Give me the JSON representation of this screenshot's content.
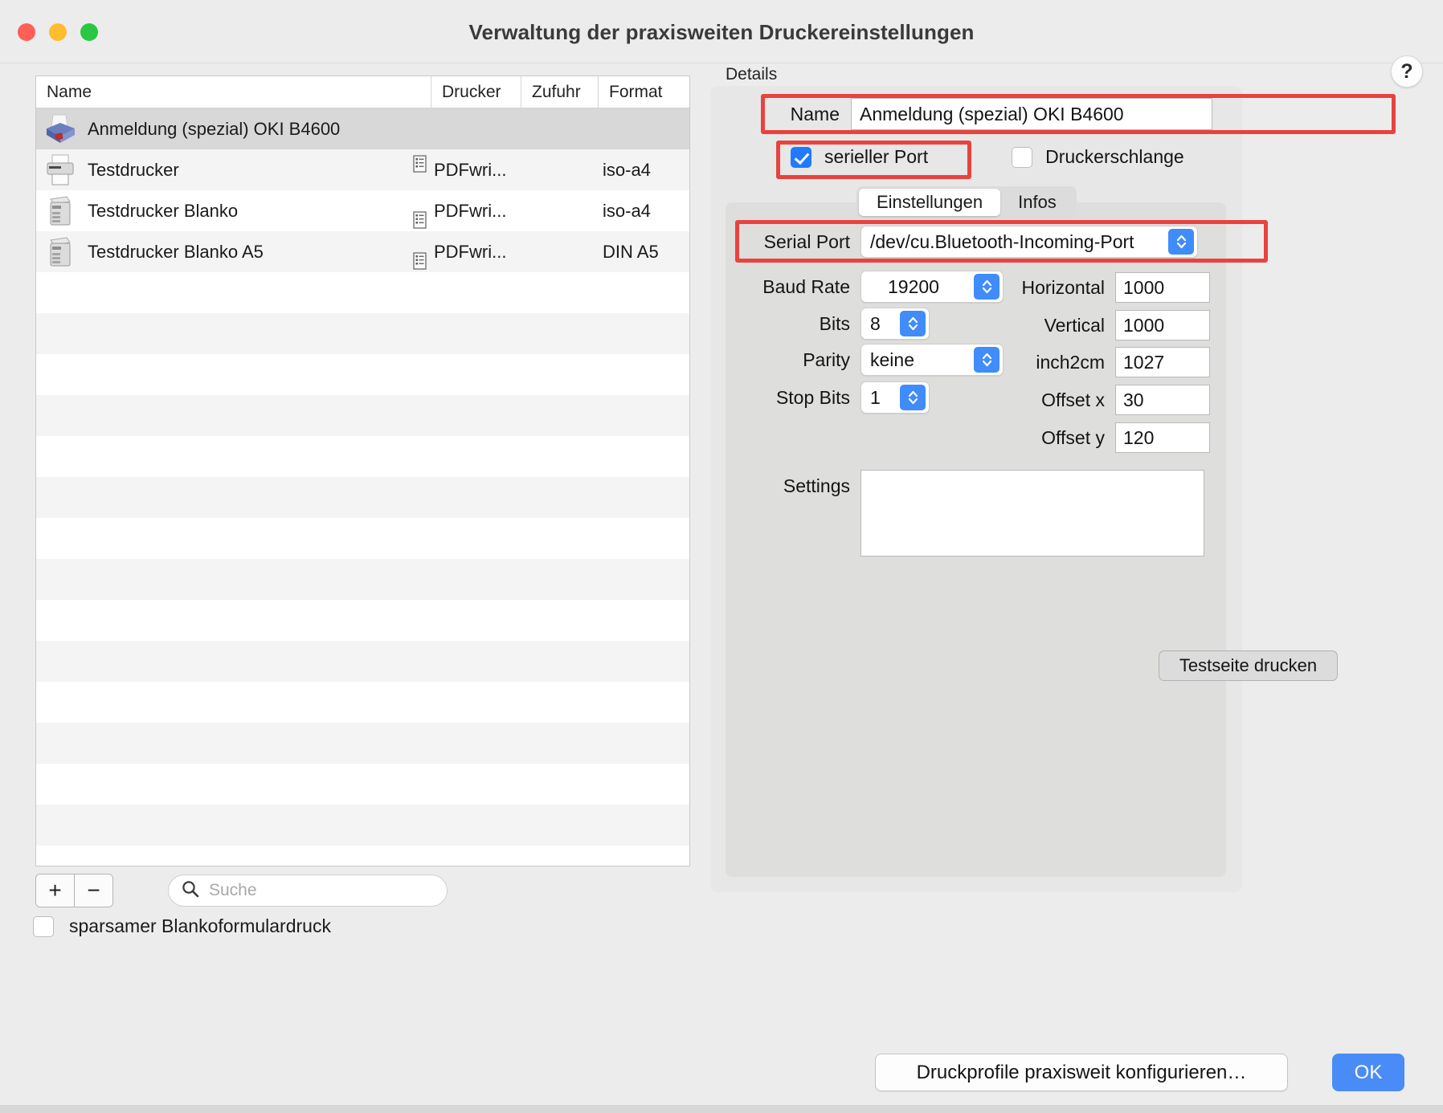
{
  "window": {
    "title": "Verwaltung der praxisweiten Druckereinstellungen",
    "traffic_lights": [
      "close",
      "minimize",
      "zoom"
    ],
    "accent_color": "#4a8cf7",
    "highlight_color": "#e8433f"
  },
  "printer_list": {
    "columns": [
      "Name",
      "Drucker",
      "Zufuhr",
      "Format"
    ],
    "rows": [
      {
        "name": "Anmeldung (spezial) OKI B4600",
        "drucker": "",
        "zufuhr": "",
        "format": "",
        "icon": "printer-blue-icon",
        "badge": "none",
        "selected": true
      },
      {
        "name": "Testdrucker",
        "drucker": "PDFwri...",
        "zufuhr": "",
        "format": "iso-a4",
        "icon": "printer-grey-icon",
        "badge": "document-badge-up",
        "selected": false
      },
      {
        "name": "Testdrucker Blanko",
        "drucker": "PDFwri...",
        "zufuhr": "",
        "format": "iso-a4",
        "icon": "printer-tower-icon",
        "badge": "document-badge-down",
        "selected": false
      },
      {
        "name": "Testdrucker Blanko A5",
        "drucker": "PDFwri...",
        "zufuhr": "",
        "format": "DIN A5",
        "icon": "printer-tower-icon",
        "badge": "document-badge-down",
        "selected": false
      }
    ],
    "empty_row_count": 17
  },
  "list_toolbar": {
    "add_label": "+",
    "remove_label": "−",
    "search_placeholder": "Suche",
    "search_value": ""
  },
  "footer": {
    "sparsam_label": "sparsamer Blankoformulardruck",
    "sparsam_checked": false,
    "profile_button": "Druckprofile praxisweit konfigurieren…",
    "ok_button": "OK"
  },
  "details": {
    "section_label": "Details",
    "help_label": "?",
    "name_label": "Name",
    "name_value": "Anmeldung (spezial) OKI B4600",
    "checkboxes": [
      {
        "label": "serieller Port",
        "checked": true
      },
      {
        "label": "Druckerschlange",
        "checked": false
      }
    ],
    "tabs": [
      {
        "label": "Einstellungen",
        "active": true
      },
      {
        "label": "Infos",
        "active": false
      }
    ],
    "fields_left": [
      {
        "label": "Serial Port",
        "value": "/dev/cu.Bluetooth-Incoming-Port",
        "type": "popup"
      },
      {
        "label": "Baud Rate",
        "value": "19200",
        "type": "popup"
      },
      {
        "label": "Bits",
        "value": "8",
        "type": "popup"
      },
      {
        "label": "Parity",
        "value": "keine",
        "type": "popup"
      },
      {
        "label": "Stop Bits",
        "value": "1",
        "type": "popup"
      }
    ],
    "fields_right": [
      {
        "label": "Horizontal",
        "value": "1000",
        "type": "text"
      },
      {
        "label": "Vertical",
        "value": "1000",
        "type": "text"
      },
      {
        "label": "inch2cm",
        "value": "1027",
        "type": "text"
      },
      {
        "label": "Offset x",
        "value": "30",
        "type": "text"
      },
      {
        "label": "Offset y",
        "value": "120",
        "type": "text"
      }
    ],
    "settings_label": "Settings",
    "settings_value": "",
    "testprint_button": "Testseite drucken"
  }
}
